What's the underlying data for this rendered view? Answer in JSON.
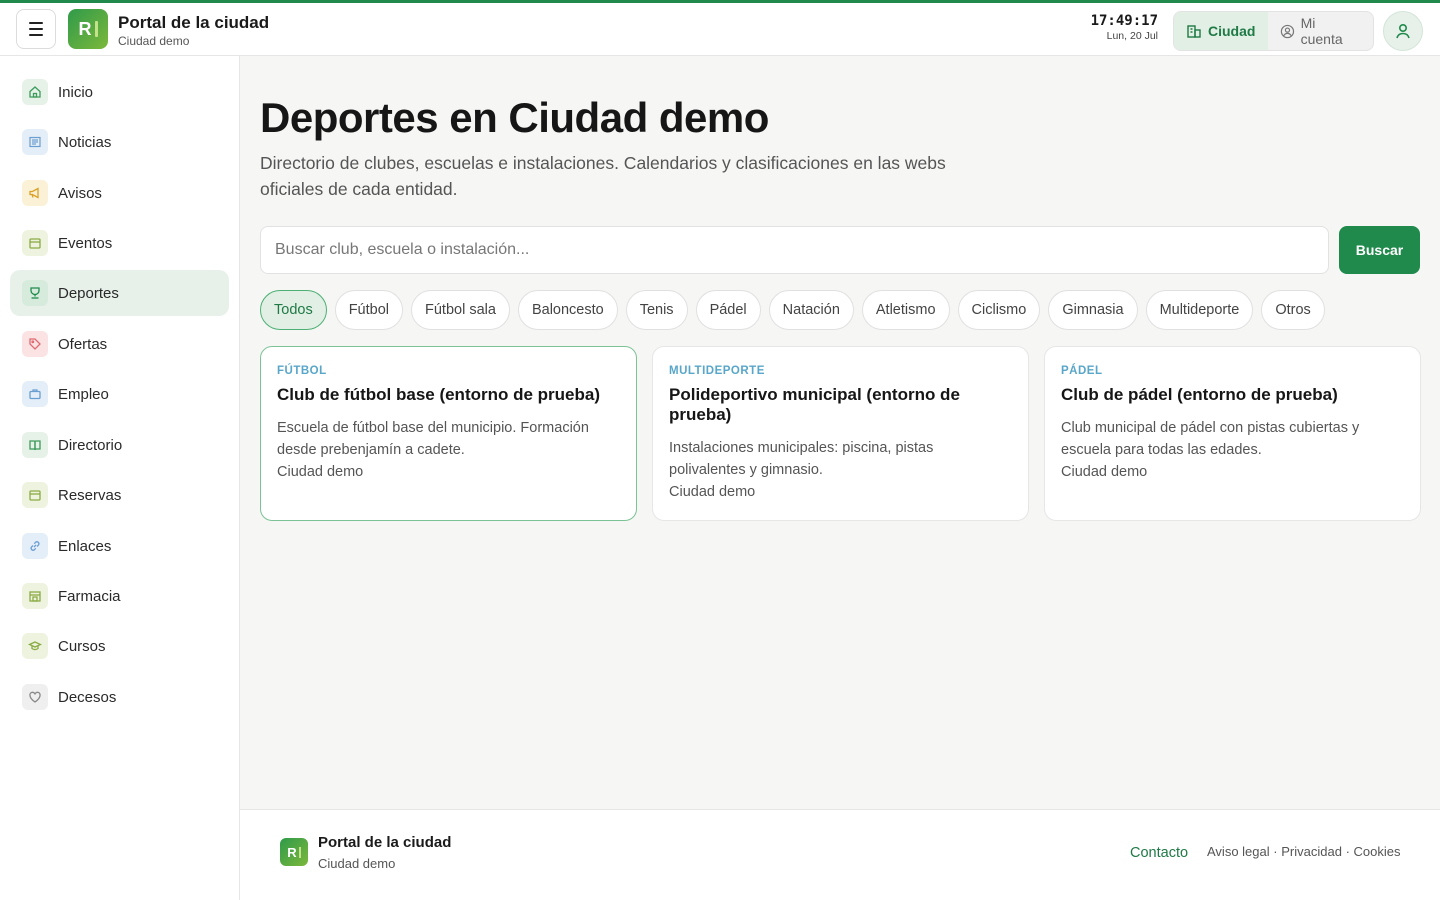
{
  "header": {
    "title": "Portal de la ciudad",
    "subtitle": "Ciudad demo",
    "logo_letter": "R",
    "time": "17:49:17",
    "date": "Lun, 20 Jul",
    "segments": [
      {
        "label": "Ciudad",
        "icon": "building-icon",
        "active": true
      },
      {
        "label": "Mi cuenta",
        "icon": "user-circle-icon",
        "active": false
      }
    ]
  },
  "sidebar": {
    "items": [
      {
        "label": "Inicio",
        "icon": "home-icon",
        "color": "#e6f2e8"
      },
      {
        "label": "Noticias",
        "icon": "newspaper-icon",
        "color": "#e4eef8"
      },
      {
        "label": "Avisos",
        "icon": "megaphone-icon",
        "color": "#fbf1d6"
      },
      {
        "label": "Eventos",
        "icon": "calendar-icon",
        "color": "#eef3df"
      },
      {
        "label": "Deportes",
        "icon": "trophy-icon",
        "color": "#d6ebdc",
        "active": true
      },
      {
        "label": "Ofertas",
        "icon": "tag-icon",
        "color": "#fbe3e4"
      },
      {
        "label": "Empleo",
        "icon": "briefcase-icon",
        "color": "#e4eef8"
      },
      {
        "label": "Directorio",
        "icon": "book-icon",
        "color": "#e6f2e8"
      },
      {
        "label": "Reservas",
        "icon": "calendar-icon",
        "color": "#eef3df"
      },
      {
        "label": "Enlaces",
        "icon": "link-icon",
        "color": "#e4eef8"
      },
      {
        "label": "Farmacia",
        "icon": "pharmacy-icon",
        "color": "#eef3df"
      },
      {
        "label": "Cursos",
        "icon": "graduation-cap-icon",
        "color": "#eef3df"
      },
      {
        "label": "Decesos",
        "icon": "heart-icon",
        "color": "#efefef"
      }
    ]
  },
  "main": {
    "title": "Deportes en Ciudad demo",
    "subtitle": "Directorio de clubes, escuelas e instalaciones. Calendarios y clasificaciones en las webs oficiales de cada entidad.",
    "search_placeholder": "Buscar club, escuela o instalación...",
    "search_button": "Buscar",
    "filters": [
      "Todos",
      "Fútbol",
      "Fútbol sala",
      "Baloncesto",
      "Tenis",
      "Pádel",
      "Natación",
      "Atletismo",
      "Ciclismo",
      "Gimnasia",
      "Multideporte",
      "Otros"
    ],
    "active_filter": "Todos",
    "cards": [
      {
        "category": "FÚTBOL",
        "title": "Club de fútbol base (entorno de prueba)",
        "description": "Escuela de fútbol base del municipio. Formación desde prebenjamín a cadete.",
        "location": "Ciudad demo"
      },
      {
        "category": "MULTIDEPORTE",
        "title": "Polideportivo municipal (entorno de prueba)",
        "description": "Instalaciones municipales: piscina, pistas polivalentes y gimnasio.",
        "location": "Ciudad demo"
      },
      {
        "category": "PÁDEL",
        "title": "Club de pádel (entorno de prueba)",
        "description": "Club municipal de pádel con pistas cubiertas y escuela para todas las edades.",
        "location": "Ciudad demo"
      }
    ]
  },
  "footer": {
    "title": "Portal de la ciudad",
    "subtitle": "Ciudad demo",
    "logo_letter": "R",
    "contact": "Contacto",
    "legal_links": [
      "Aviso legal",
      "Privacidad",
      "Cookies"
    ],
    "separator": "·"
  },
  "colors": {
    "brand": "#1f8a4c",
    "brand_light": "#e2efe5",
    "category": "#58a6c9"
  }
}
